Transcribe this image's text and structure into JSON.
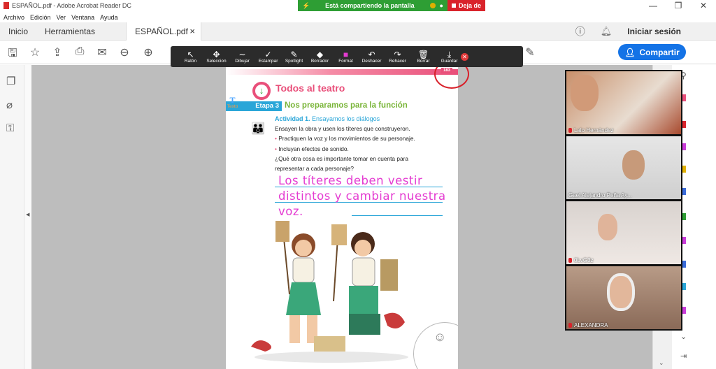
{
  "window": {
    "title": "ESPAÑOL.pdf - Adobe Acrobat Reader DC",
    "controls": [
      "—",
      "❐",
      "✕"
    ]
  },
  "share": {
    "status": "Está compartiendo la pantalla",
    "stop_label": "Deja de"
  },
  "menu": [
    "Archivo",
    "Edición",
    "Ver",
    "Ventana",
    "Ayuda"
  ],
  "tabs": {
    "home": "Inicio",
    "tools": "Herramientas",
    "doc": "ESPAÑOL.pdf",
    "close": "×",
    "signin": "Iniciar sesión"
  },
  "toolbar": {
    "share_label": "Compartir"
  },
  "annotate": {
    "tools": [
      {
        "label": "Ratón",
        "glyph": "↖"
      },
      {
        "label": "Seleccion",
        "glyph": "✥"
      },
      {
        "label": "Texto",
        "glyph": "T"
      },
      {
        "label": "Dibujar",
        "glyph": "∼"
      },
      {
        "label": "Estampar",
        "glyph": "✓"
      },
      {
        "label": "Spotlight",
        "glyph": "✎"
      },
      {
        "label": "Borrador",
        "glyph": "◆"
      },
      {
        "label": "Format",
        "glyph": "■"
      },
      {
        "label": "Deshacer",
        "glyph": "↶"
      },
      {
        "label": "Rehacer",
        "glyph": "↷"
      },
      {
        "label": "Borrar",
        "glyph": "🗑"
      },
      {
        "label": "Guardar",
        "glyph": "⤓"
      }
    ],
    "active": "Texto",
    "close": "✕"
  },
  "page": {
    "number": "183",
    "title": "Todos al teatro",
    "stage_label": "Etapa 3",
    "stage_title": "Nos preparamos para la función",
    "activity_label": "Actividad 1.",
    "activity_title": "Ensayamos los diálogos",
    "intro": "Ensayen la obra y usen los títeres que construyeron.",
    "bullets": [
      "Practiquen la voz y los movimientos de su personaje.",
      "Incluyan efectos de sonido."
    ],
    "question_1": "¿Qué otra cosa es importante tomar en cuenta para",
    "question_2": "representar a cada personaje?",
    "handwriting": [
      "Los títeres deben vestir",
      "distintos y cambiar nuestra",
      "voz."
    ]
  },
  "participants": [
    {
      "name": "Lalo Hernández"
    },
    {
      "name": "Gael Alejandro Peña Ay..."
    },
    {
      "name": "0LvG3z"
    },
    {
      "name": "ALEXANDRA"
    }
  ]
}
